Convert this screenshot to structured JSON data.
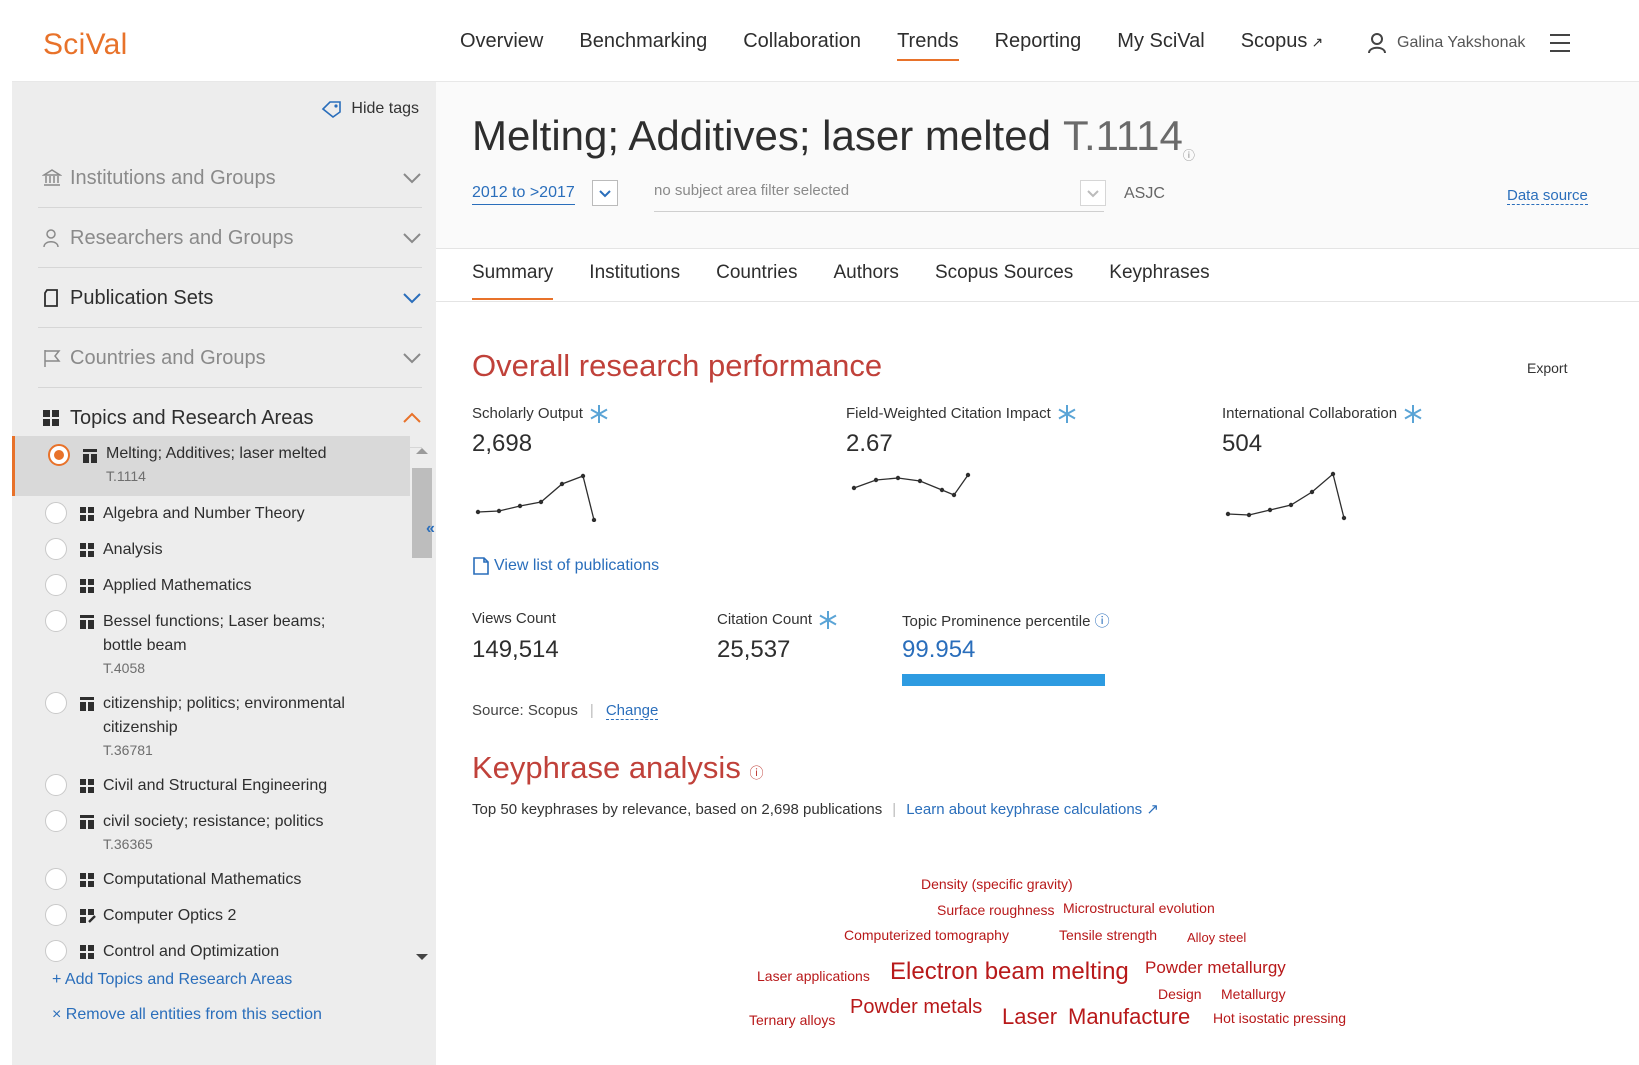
{
  "app": {
    "logo": "SciVal",
    "nav": [
      {
        "label": "Overview"
      },
      {
        "label": "Benchmarking"
      },
      {
        "label": "Collaboration"
      },
      {
        "label": "Trends",
        "active": true
      },
      {
        "label": "Reporting"
      },
      {
        "label": "My SciVal"
      },
      {
        "label": "Scopus",
        "external_mark": "↗"
      }
    ],
    "user_name": "Galina Yakshonak"
  },
  "sidebar": {
    "hide_tags": "Hide tags",
    "sections": [
      {
        "label": "Institutions and Groups",
        "icon": "institution-icon",
        "state": "collapsed"
      },
      {
        "label": "Researchers and Groups",
        "icon": "person-icon",
        "state": "collapsed"
      },
      {
        "label": "Publication Sets",
        "icon": "document-icon",
        "state": "collapsed"
      },
      {
        "label": "Countries and Groups",
        "icon": "flag-icon",
        "state": "collapsed"
      },
      {
        "label": "Topics and Research Areas",
        "icon": "grid-icon",
        "state": "expanded"
      }
    ],
    "items": [
      {
        "label": "Melting; Additives; laser melted",
        "code": "T.1114",
        "icon": "topic-icon",
        "selected": true
      },
      {
        "label": "Algebra and Number Theory",
        "icon": "grid-icon"
      },
      {
        "label": "Analysis",
        "icon": "grid-icon"
      },
      {
        "label": "Applied Mathematics",
        "icon": "grid-icon"
      },
      {
        "label": "Bessel functions; Laser beams;",
        "label2": "bottle beam",
        "code": "T.4058",
        "icon": "topic-icon"
      },
      {
        "label": "citizenship; politics; environmental",
        "label2": "citizenship",
        "code": "T.36781",
        "icon": "topic-icon"
      },
      {
        "label": "Civil and Structural Engineering",
        "icon": "grid-icon"
      },
      {
        "label": "civil society; resistance; politics",
        "code": "T.36365",
        "icon": "topic-icon"
      },
      {
        "label": "Computational Mathematics",
        "icon": "grid-icon"
      },
      {
        "label": "Computer Optics 2",
        "icon": "grid-edit-icon"
      },
      {
        "label": "Control and Optimization",
        "icon": "grid-icon"
      }
    ],
    "add_link": "Add Topics and Research Areas",
    "remove_link": "Remove all entities from this section"
  },
  "main": {
    "title": "Melting; Additives; laser melted",
    "topic_id": "T.1114",
    "date_range": "2012 to >2017",
    "subject_filter_placeholder": "no subject area filter selected",
    "asjc": "ASJC",
    "data_source": "Data source",
    "tabs": [
      {
        "label": "Summary",
        "active": true
      },
      {
        "label": "Institutions"
      },
      {
        "label": "Countries"
      },
      {
        "label": "Authors"
      },
      {
        "label": "Scopus Sources"
      },
      {
        "label": "Keyphrases"
      }
    ],
    "overall_title": "Overall research performance",
    "export": "Export",
    "metrics": [
      {
        "label": "Scholarly Output",
        "value": "2,698"
      },
      {
        "label": "Field-Weighted Citation Impact",
        "value": "2.67"
      },
      {
        "label": "International Collaboration",
        "value": "504"
      }
    ],
    "view_list": "View list of publications",
    "views_label": "Views Count",
    "views_value": "149,514",
    "citation_label": "Citation Count",
    "citation_value": "25,537",
    "prominence_label": "Topic Prominence percentile",
    "prominence_value": "99.954",
    "prominence_fraction": 0.9995,
    "source_label": "Source: Scopus",
    "change": "Change",
    "keyphrase_title": "Keyphrase analysis",
    "keyphrase_sub": "Top 50 keyphrases by relevance, based on 2,698 publications",
    "keyphrase_link": "Learn about keyphrase calculations ↗",
    "cloud": [
      "Density (specific gravity)",
      "Surface roughness",
      "Microstructural evolution",
      "Computerized tomography",
      "Tensile strength",
      "Alloy steel",
      "Laser applications",
      "Electron beam melting",
      "Powder metallurgy",
      "Design",
      "Metallurgy",
      "Ternary alloys",
      "Powder metals",
      "Laser",
      "Manufacture",
      "Hot isostatic pressing"
    ]
  },
  "colors": {
    "accent": "#e8722a",
    "link": "#2a6ebb",
    "heading": "#c0413a",
    "cloud": "#b8191a",
    "bar": "#2d9be1"
  }
}
